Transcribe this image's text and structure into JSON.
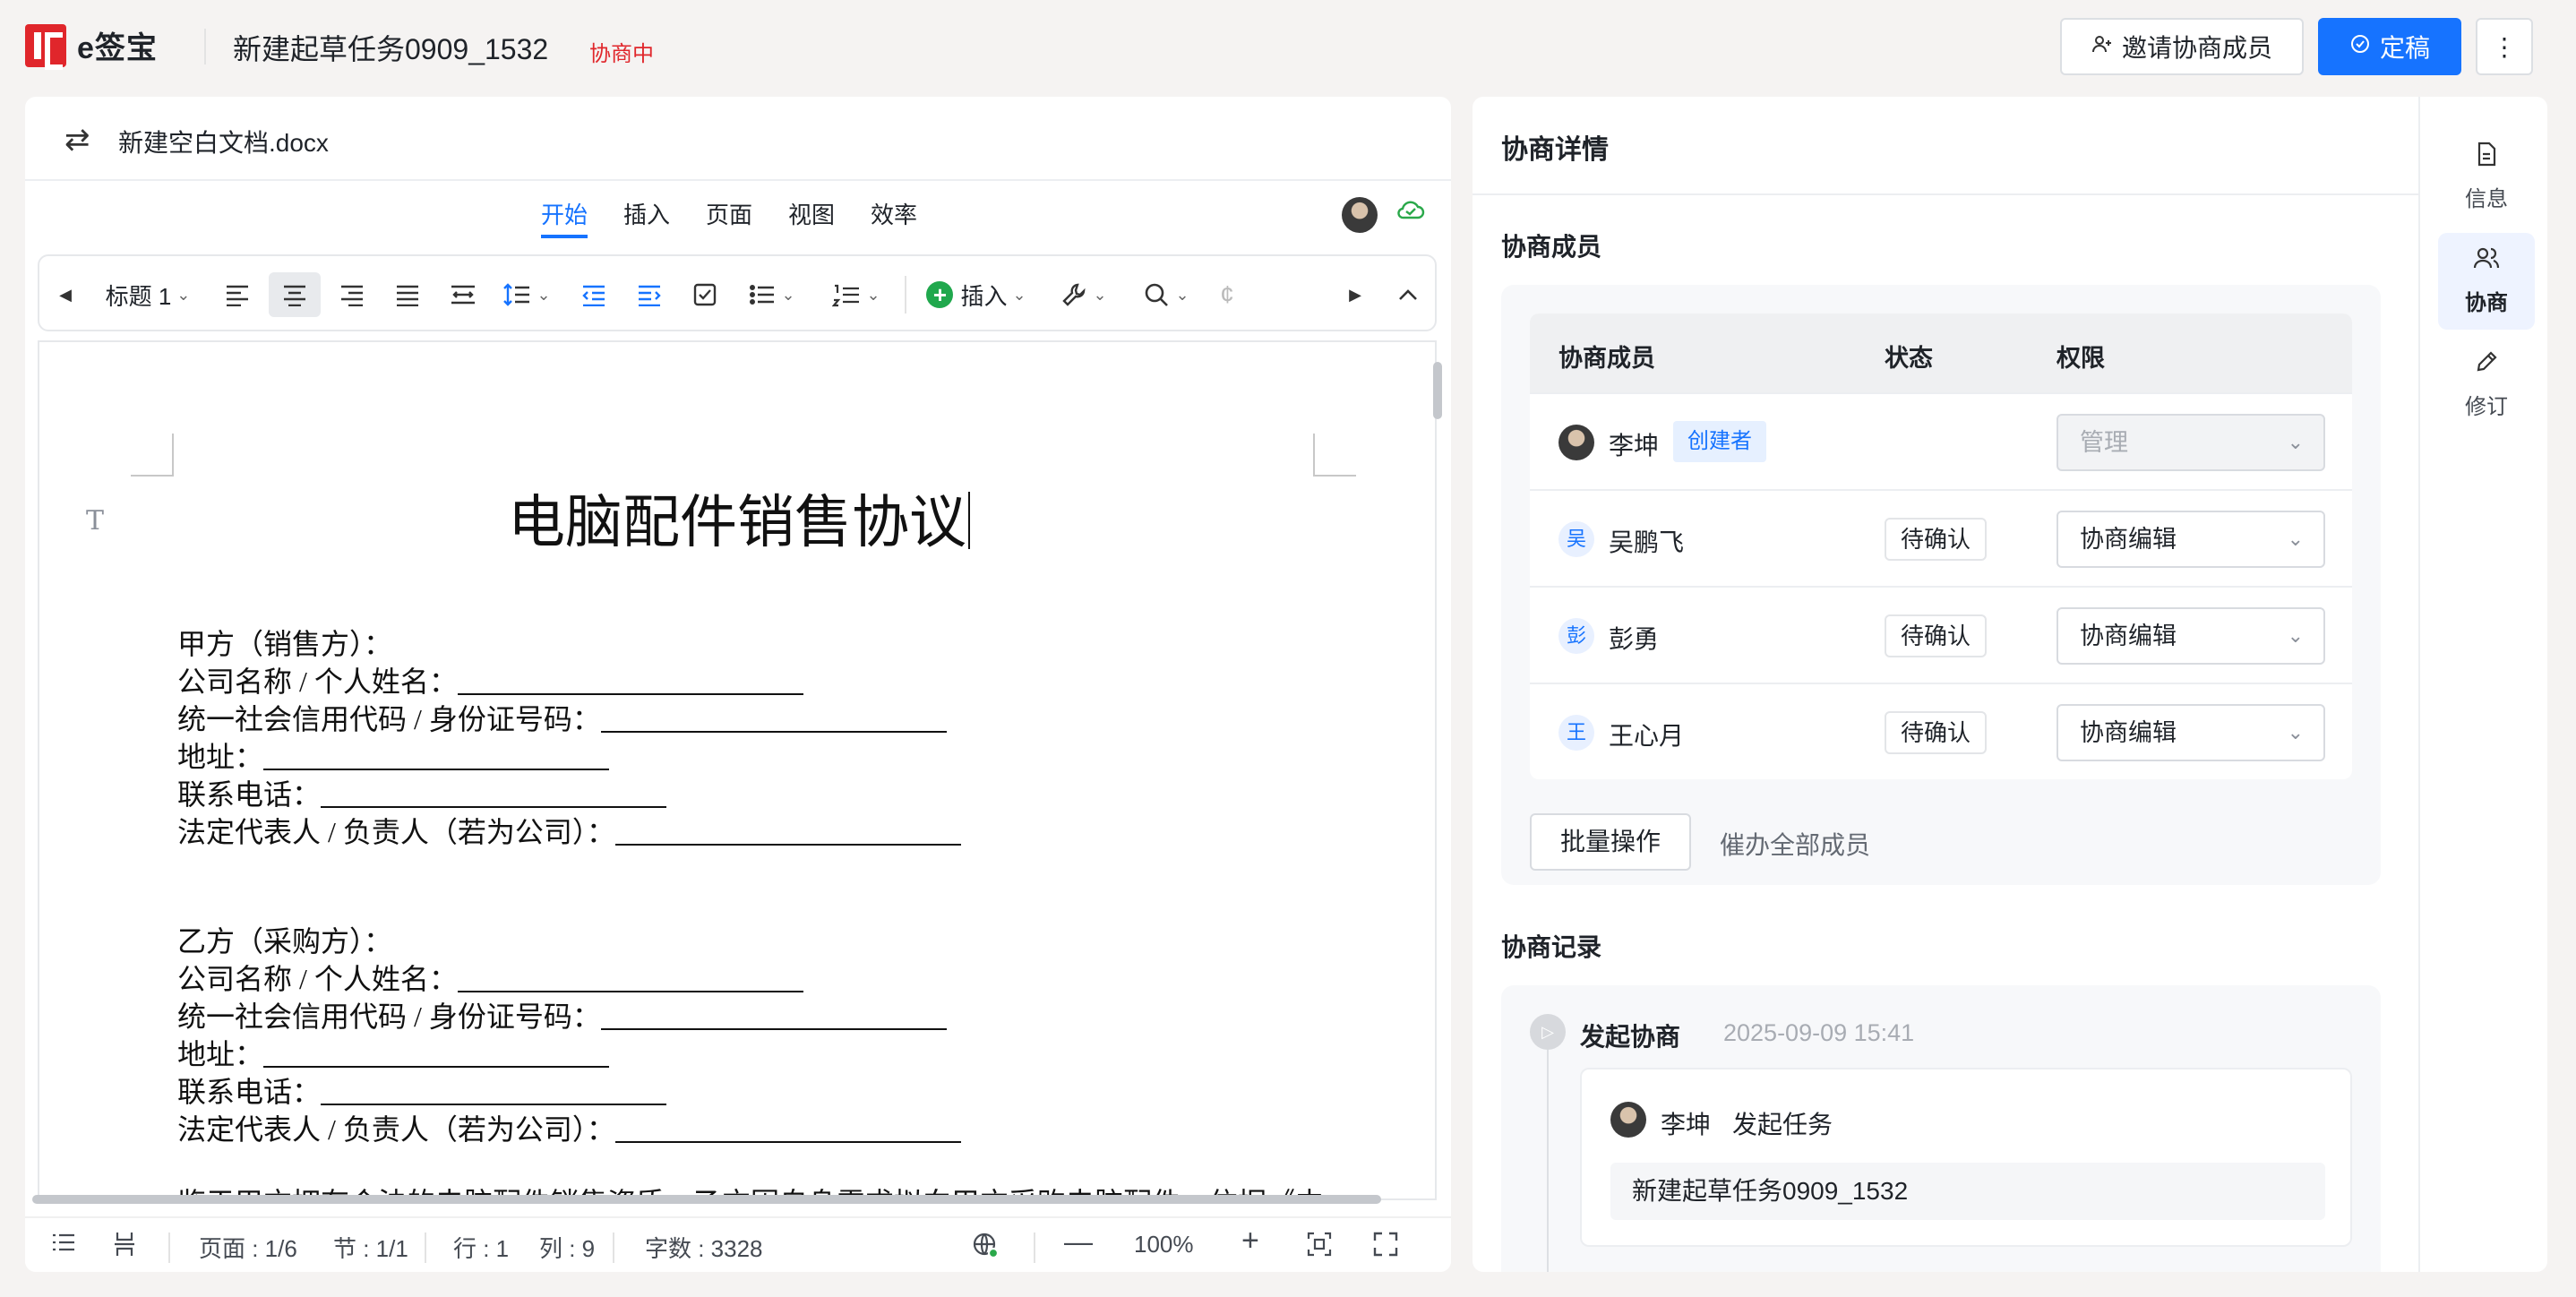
{
  "header": {
    "logo_text": "e签宝",
    "task_title": "新建起草任务0909_1532",
    "task_status": "协商中",
    "invite_label": "邀请协商成员",
    "finalize_label": "定稿",
    "more_label": "⋮"
  },
  "editor": {
    "file_name": "新建空白文档.docx",
    "tabs": [
      "开始",
      "插入",
      "页面",
      "视图",
      "效率"
    ],
    "toolbar": {
      "heading_style": "标题 1",
      "insert_label": "插入"
    },
    "document": {
      "title": "电脑配件销售协议",
      "party_a": [
        "甲方（销售方）：",
        "公司名称 / 个人姓名：",
        "统一社会信用代码 / 身份证号码：",
        "地址：",
        "联系电话：",
        "法定代表人 / 负责人（若为公司）："
      ],
      "party_b": [
        "乙方（采购方）：",
        "公司名称 / 个人姓名：",
        "统一社会信用代码 / 身份证号码：",
        "地址：",
        "联系电话：",
        "法定代表人 / 负责人（若为公司）："
      ],
      "partial_line": "鉴于甲方拥有合法的电脑配件销售资质，乙方因自身需求拟向甲方采购电脑配件，依据《中"
    },
    "status_bar": {
      "page": "页面 : 1/6",
      "section": "节 : 1/1",
      "row": "行 : 1",
      "col": "列 : 9",
      "word_count": "字数 : 3328",
      "zoom": "100%"
    }
  },
  "right_panel": {
    "title": "协商详情",
    "members_label": "协商成员",
    "table_headers": [
      "协商成员",
      "状态",
      "权限"
    ],
    "members": [
      {
        "name": "李坤",
        "avatar": "",
        "tag": "创建者",
        "status": "",
        "permission": "管理",
        "disabled": true
      },
      {
        "name": "吴鹏飞",
        "avatar": "吴",
        "tag": "",
        "status": "待确认",
        "permission": "协商编辑",
        "disabled": false
      },
      {
        "name": "彭勇",
        "avatar": "彭",
        "tag": "",
        "status": "待确认",
        "permission": "协商编辑",
        "disabled": false
      },
      {
        "name": "王心月",
        "avatar": "王",
        "tag": "",
        "status": "待确认",
        "permission": "协商编辑",
        "disabled": false
      }
    ],
    "batch_label": "批量操作",
    "urge_label": "催办全部成员",
    "records_label": "协商记录",
    "record": {
      "title": "发起协商",
      "time": "2025-09-09 15:41",
      "user": "李坤",
      "action": "发起任务",
      "content": "新建起草任务0909_1532"
    }
  },
  "side_nav": [
    {
      "label": "信息",
      "icon": "document-icon"
    },
    {
      "label": "协商",
      "icon": "users-icon"
    },
    {
      "label": "修订",
      "icon": "pencil-icon"
    }
  ],
  "colors": {
    "brand_red": "#e0262b",
    "primary_blue": "#1673ff",
    "success_green": "#20a84d"
  }
}
